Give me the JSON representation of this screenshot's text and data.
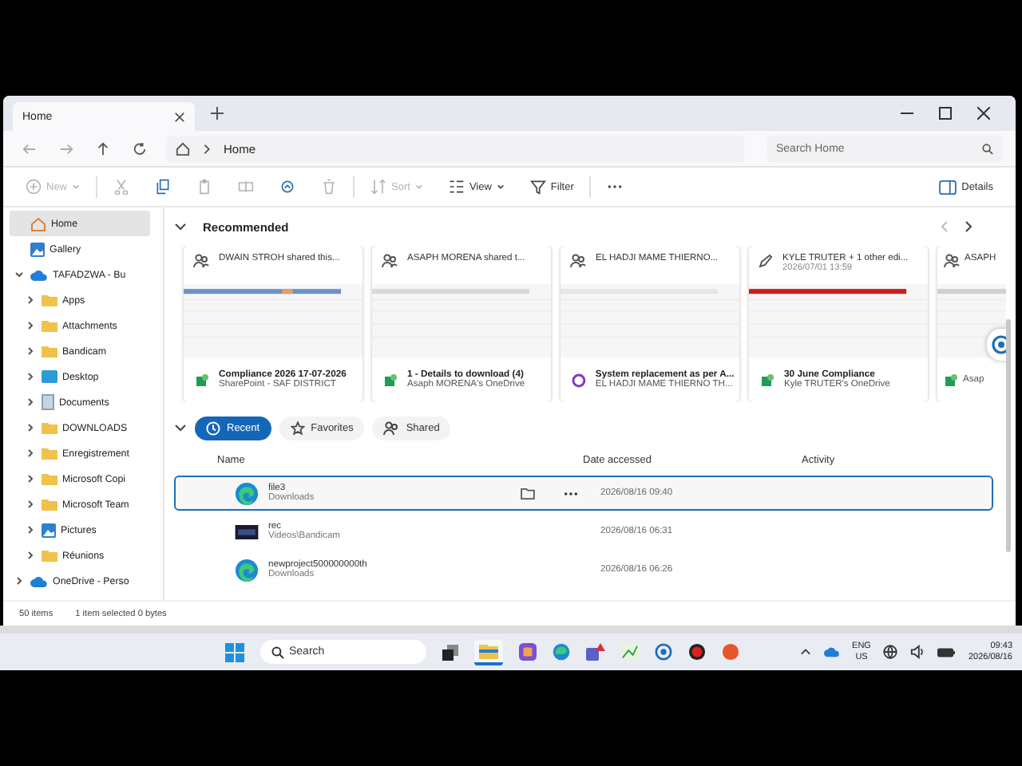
{
  "window": {
    "tabs": [
      {
        "label": "Home",
        "selected": true
      }
    ]
  },
  "address": {
    "path": "Home",
    "search_placeholder": "Search Home"
  },
  "toolbar": {
    "items": [
      {
        "kind": "new",
        "label": "New",
        "disabled": true
      },
      {
        "kind": "cut",
        "disabled": true
      },
      {
        "kind": "copy",
        "disabled": false
      },
      {
        "kind": "paste",
        "disabled": true
      },
      {
        "kind": "rename",
        "disabled": true
      },
      {
        "kind": "share",
        "disabled": false
      },
      {
        "kind": "delete",
        "disabled": true
      },
      {
        "kind": "sort",
        "label": "Sort",
        "disabled": true
      },
      {
        "kind": "view",
        "label": "View",
        "disabled": false
      },
      {
        "kind": "filter",
        "label": "Filter",
        "disabled": false
      },
      {
        "kind": "more",
        "disabled": false
      }
    ],
    "details": "Details"
  },
  "sidebar": {
    "items": [
      {
        "kind": "home",
        "label": "Home",
        "selected": true
      },
      {
        "kind": "gallery",
        "label": "Gallery",
        "selected": false
      },
      {
        "kind": "cloud",
        "label": "TAFADZWA - Bu",
        "selected": false,
        "expanded": true,
        "children": [
          {
            "kind": "folder",
            "label": "Apps",
            "selected": false,
            "expanded": false
          },
          {
            "kind": "folder",
            "label": "Attachments",
            "selected": false,
            "expanded": false
          },
          {
            "kind": "folder",
            "label": "Bandicam",
            "selected": false,
            "expanded": false
          },
          {
            "kind": "desktop",
            "label": "Desktop",
            "selected": false,
            "expanded": false
          },
          {
            "kind": "documents",
            "label": "Documents",
            "selected": false,
            "expanded": false
          },
          {
            "kind": "folder",
            "label": "DOWNLOADS",
            "selected": false,
            "expanded": false
          },
          {
            "kind": "folder",
            "label": "Enregistrement",
            "selected": false,
            "expanded": false
          },
          {
            "kind": "folder",
            "label": "Microsoft Copi",
            "selected": false,
            "expanded": false
          },
          {
            "kind": "folder",
            "label": "Microsoft Team",
            "selected": false,
            "expanded": false
          },
          {
            "kind": "pictures",
            "label": "Pictures",
            "selected": false,
            "expanded": false
          },
          {
            "kind": "folder",
            "label": "Réunions",
            "selected": false,
            "expanded": false
          }
        ]
      },
      {
        "kind": "cloud",
        "label": "OneDrive - Perso",
        "selected": false,
        "expanded": false
      }
    ]
  },
  "recommended": {
    "title": "Recommended",
    "expanded": true,
    "cards": [
      {
        "kind": "shared",
        "activity": "DWAIN STROH shared this...",
        "file": {
          "kind": "sheet",
          "name": "Compliance 2026 17-07-2026",
          "location": "SharePoint - SAF DISTRICT"
        }
      },
      {
        "kind": "shared",
        "activity": "ASAPH MORENA shared t...",
        "file": {
          "kind": "sheet",
          "name": "1 - Details to download (4)",
          "location": "Asaph MORENA's OneDrive"
        }
      },
      {
        "kind": "shared",
        "activity": "EL HADJI MAME THIERNO...",
        "file": {
          "kind": "form",
          "name": "System replacement as per A...",
          "location": "EL HADJI MAME THIERNO TH..."
        }
      },
      {
        "kind": "edited",
        "activity": "KYLE TRUTER + 1 other edi...",
        "date": "2026/07/01 13:59",
        "file": {
          "kind": "sheet",
          "name": "30 June Compliance",
          "location": "Kyle TRUTER's OneDrive"
        }
      },
      {
        "kind": "shared",
        "activity": "ASAPH",
        "file": {
          "kind": "sheet",
          "location": "Asap"
        }
      }
    ]
  },
  "files": {
    "expanded": true,
    "tabs": [
      {
        "kind": "recent",
        "label": "Recent",
        "selected": true
      },
      {
        "kind": "star",
        "label": "Favorites",
        "selected": false
      },
      {
        "kind": "people",
        "label": "Shared",
        "selected": false
      }
    ],
    "columns": [
      "Name",
      "Date accessed",
      "Activity"
    ],
    "rows": [
      {
        "kind": "edge",
        "name": "file3",
        "location": "Downloads",
        "date": "2026/08/16 09:40",
        "selected": true
      },
      {
        "kind": "video",
        "name": "rec",
        "location": "Videos\\Bandicam",
        "date": "2026/08/16 06:31",
        "selected": false
      },
      {
        "kind": "edge",
        "name": "newproject500000000th",
        "location": "Downloads",
        "date": "2026/08/16 06:26",
        "selected": false
      }
    ]
  },
  "status_bar": {
    "count": "50 items",
    "selection": "1 item selected  0 bytes"
  },
  "taskbar": {
    "search_placeholder": "Search",
    "language": "ENG",
    "region": "US",
    "time": "09:43",
    "date": "2026/08/16"
  }
}
